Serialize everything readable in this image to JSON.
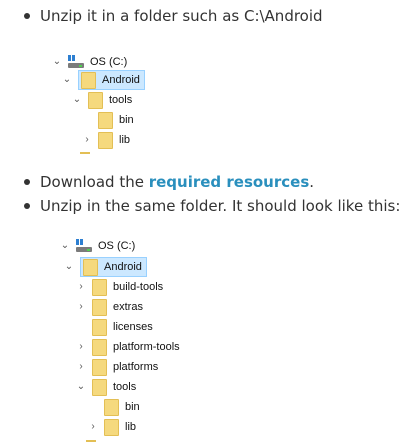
{
  "bullets": {
    "b1": "Unzip it in a folder such as C:\\Android",
    "b2_pre": "Download the ",
    "b2_link": "required resources",
    "b2_post": ".",
    "b3": "Unzip in the same folder. It should look like this:"
  },
  "tree1": {
    "drive": "OS (C:)",
    "android": "Android",
    "tools": "tools",
    "bin": "bin",
    "lib": "lib"
  },
  "tree2": {
    "drive": "OS (C:)",
    "android": "Android",
    "items": [
      "build-tools",
      "extras",
      "licenses",
      "platform-tools",
      "platforms",
      "tools"
    ],
    "bin": "bin",
    "lib": "lib"
  },
  "colors": {
    "link": "#2a8fbd",
    "folder": "#f5d97e",
    "selection": "#cce8ff"
  },
  "icons": {
    "drive": "drive-icon",
    "folder": "folder-icon",
    "expanded": "chevron-down-icon",
    "collapsed": "chevron-right-icon"
  }
}
